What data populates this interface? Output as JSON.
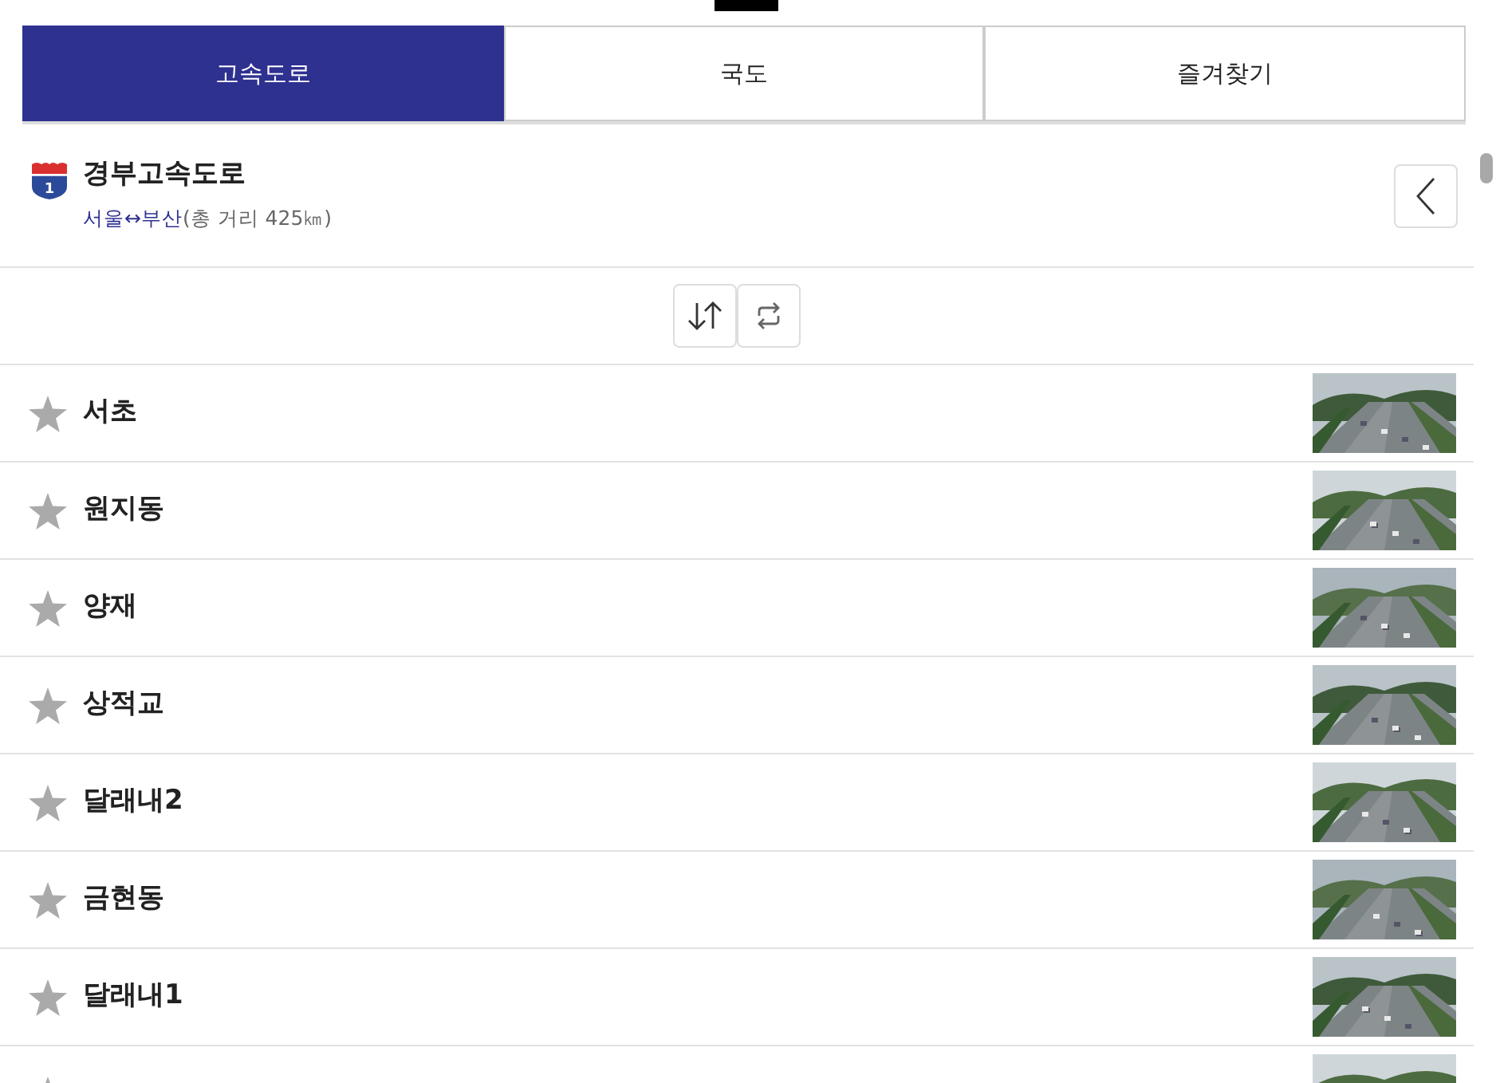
{
  "tabs": [
    {
      "label": "고속도로",
      "selected": true
    },
    {
      "label": "국도",
      "selected": false
    },
    {
      "label": "즐겨찾기",
      "selected": false
    }
  ],
  "route": {
    "badge": "1",
    "title": "경부고속도로",
    "endpoints": "서울↔부산",
    "distance": "(총 거리 425㎞)"
  },
  "cameras": [
    {
      "name": "서초",
      "favorite": false
    },
    {
      "name": "원지동",
      "favorite": false
    },
    {
      "name": "양재",
      "favorite": false
    },
    {
      "name": "상적교",
      "favorite": false
    },
    {
      "name": "달래내2",
      "favorite": false
    },
    {
      "name": "금현동",
      "favorite": false
    },
    {
      "name": "달래내1",
      "favorite": false
    },
    {
      "favorite": false
    }
  ]
}
